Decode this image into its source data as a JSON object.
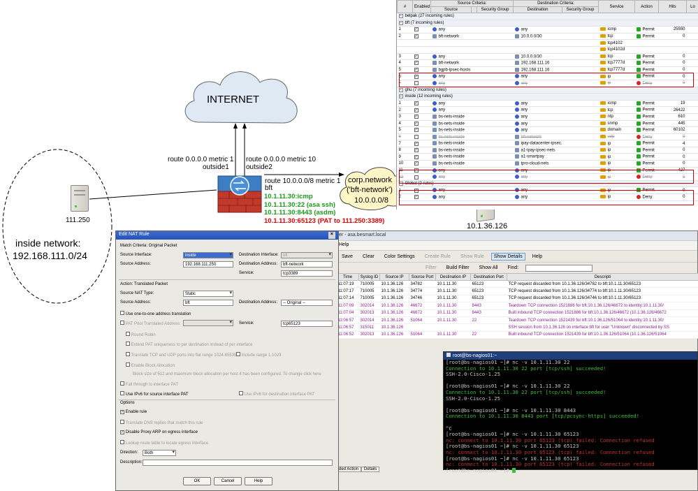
{
  "diagram": {
    "internet_label": "INTERNET",
    "route1": "route 0.0.0.0 metric 1",
    "route1_iface": "outside1",
    "route2": "route 0.0.0.0 metric 10",
    "route2_iface": "outside2",
    "route3": "route 10.0.0.0/8 metric 1",
    "route3_iface": "bft",
    "fw_lines": [
      {
        "text": "10.1.11.30:icmp",
        "color": "#1a9a1a"
      },
      {
        "text": "10.1.11.30:22 (asa ssh)",
        "color": "#1a9a1a"
      },
      {
        "text": "10.1.11.30:8443 (asdm)",
        "color": "#1a9a1a"
      },
      {
        "text": "10.1.11.30:65123 (PAT to 111.250:3389)",
        "color": "#e00000"
      }
    ],
    "corp_line1": "corp.network",
    "corp_line2": "('bft-network')",
    "corp_line3": "10.0.0.0/8",
    "left_server_label": "111.250",
    "inside_line1": "inside network:",
    "inside_line2": "192.168.111.0/24",
    "right_server_label": "10.1.36.126"
  },
  "acl": {
    "headers": {
      "num": "#",
      "enabled": "Enabled",
      "src_crit": "Source Criteria:",
      "dst_crit": "Destination Criteria:",
      "source": "Source",
      "sg": "Security Group",
      "destination": "Destination",
      "dsg": "Security Group",
      "service": "Service",
      "action": "Action",
      "hits": "Hits",
      "lo": "Lo"
    },
    "rows": [
      {
        "type": "grp",
        "text": "belpak (27 incoming rules)"
      },
      {
        "type": "grp",
        "text": "bft (7 incoming rules)"
      },
      {
        "n": "1",
        "src": "any",
        "dst": "any",
        "svc": "icmp",
        "act": "Permit",
        "hits": "25550"
      },
      {
        "n": "2",
        "src": "bft-network",
        "dst": "10.0.0.0/30",
        "svc": "tcp",
        "act": "Permit",
        "hits": "0"
      },
      {
        "n": "",
        "src": "",
        "dst": "",
        "svc": "tcp4102",
        "act": "",
        "hits": ""
      },
      {
        "n": "",
        "src": "",
        "dst": "",
        "svc": "tcp4102d",
        "act": "",
        "hits": ""
      },
      {
        "n": "3",
        "src": "any",
        "dst": "10.0.0.0/30",
        "svc": "tcp",
        "act": "Permit",
        "hits": "0"
      },
      {
        "n": "4",
        "src": "bft-network",
        "dst": "192.168.111.16",
        "svc": "tcp7777d",
        "act": "Permit",
        "hits": "0"
      },
      {
        "n": "5",
        "src": "bgpb-ipsec-hosts",
        "dst": "192.168.111.16",
        "svc": "tcp7777d",
        "act": "Permit",
        "hits": "0"
      },
      {
        "n": "6",
        "src": "any",
        "dst": "any",
        "svc": "ip",
        "act": "Permit",
        "hits": "0"
      },
      {
        "n": "7",
        "src": "any",
        "dst": "any",
        "svc": "ip",
        "act": "Deny",
        "hits": "0",
        "dis": true
      },
      {
        "type": "grp",
        "text": "ghu (7 incoming rules)"
      },
      {
        "type": "grp",
        "text": "inside (12 incoming rules)"
      },
      {
        "n": "1",
        "src": "any",
        "dst": "any",
        "svc": "icmp",
        "act": "Permit",
        "hits": "19"
      },
      {
        "n": "2",
        "src": "any",
        "dst": "any",
        "svc": "tcp",
        "act": "Permit",
        "hits": "26422"
      },
      {
        "n": "3",
        "src": "bs-nets-inside",
        "dst": "any",
        "svc": "ntp",
        "act": "Permit",
        "hits": "610"
      },
      {
        "n": "4",
        "src": "bs-nets-inside",
        "dst": "any",
        "svc": "snmp",
        "act": "Permit",
        "hits": "445"
      },
      {
        "n": "5",
        "src": "bs-nets-inside",
        "dst": "any",
        "svc": "domain",
        "act": "Permit",
        "hits": "60102"
      },
      {
        "n": "6",
        "src": "bs-nets-inside",
        "dst": "bft-network",
        "svc": "udp",
        "act": "Deny",
        "hits": "0",
        "dis": true
      },
      {
        "n": "7",
        "src": "bs-nets-inside",
        "dst": "ipay-datacenter-ipsec...",
        "svc": "ip",
        "act": "Permit",
        "hits": "4"
      },
      {
        "n": "8",
        "src": "bs-nets-inside",
        "dst": "a1-ipay-ipsec-nets",
        "svc": "ip",
        "act": "Permit",
        "hits": "0"
      },
      {
        "n": "9",
        "src": "bs-nets-inside",
        "dst": "a1-smartpay",
        "svc": "ip",
        "act": "Permit",
        "hits": "0"
      },
      {
        "n": "10",
        "src": "bs-nets-inside",
        "dst": "tpro-cloud-nets",
        "svc": "ip",
        "act": "Permit",
        "hits": "0"
      },
      {
        "n": "11",
        "src": "any",
        "dst": "any",
        "svc": "ip",
        "act": "Permit",
        "hits": "427"
      },
      {
        "n": "12",
        "src": "any",
        "dst": "any",
        "svc": "ip",
        "act": "Deny",
        "hits": "0",
        "dis": true
      },
      {
        "type": "grp",
        "text": "Global (2 rules)"
      },
      {
        "n": "1",
        "src": "any",
        "dst": "any",
        "svc": "ip",
        "act": "Permit",
        "hits": "0"
      },
      {
        "n": "2",
        "src": "any",
        "dst": "any",
        "svc": "ip",
        "act": "Deny",
        "hits": "0"
      }
    ]
  },
  "logwin": {
    "title": "er - asa.besmart.local",
    "menu_help": "Help",
    "buttons": [
      "Save",
      "Clear",
      "Color Settings",
      "Create Rule",
      "Show Rule",
      "Show Details",
      "Help"
    ],
    "filter_buttons": [
      "Filter",
      "Build Filter",
      "Show All"
    ],
    "find_label": "Find:",
    "headers": [
      "Time",
      "Syslog ID",
      "Source IP",
      "Source Port",
      "Destination IP",
      "Destination Port",
      "Descripti"
    ],
    "rows": [
      {
        "t": "11:07:19",
        "id": "710005",
        "sip": "10.1.36.126",
        "sp": "34782",
        "dip": "10.1.11.30",
        "dp": "65123",
        "d": "TCP request discarded from 10.1.36.126/34782 to bft:10.1.11.30/65123",
        "c": ""
      },
      {
        "t": "11:07:17",
        "id": "710005",
        "sip": "10.1.36.126",
        "sp": "34774",
        "dip": "10.1.11.30",
        "dp": "65123",
        "d": "TCP request discarded from 10.1.36.126/34774 to bft:10.1.11.30/65123",
        "c": ""
      },
      {
        "t": "11:07:14",
        "id": "710005",
        "sip": "10.1.36.126",
        "sp": "34746",
        "dip": "10.1.11.30",
        "dp": "65123",
        "d": "TCP request discarded from 10.1.36.126/34746 to bft:10.1.11.30/65123",
        "c": ""
      },
      {
        "t": "11:07:09",
        "id": "302014",
        "sip": "10.1.36.126",
        "sp": "46672",
        "dip": "10.1.11.30",
        "dp": "8443",
        "d": "Teardown TCP connection 1521886 for bft:10.1.36.126/46672 to identity:10.1.11.30/",
        "c": "pur"
      },
      {
        "t": "11:07:04",
        "id": "302013",
        "sip": "10.1.36.126",
        "sp": "46672",
        "dip": "10.1.11.30",
        "dp": "8443",
        "d": "Built inbound TCP connection 1521886 for bft:10.1.36.126/46672 (10.1.36.126/46672",
        "c": "pur"
      },
      {
        "t": "11:06:57",
        "id": "302014",
        "sip": "10.1.36.126",
        "sp": "51064",
        "dip": "10.1.11.30",
        "dp": "22",
        "d": "Teardown TCP connection 1521439 for bft:10.1.36.126/51064 to identity:10.1.11.30/",
        "c": "pur"
      },
      {
        "t": "11:06:57",
        "id": "315011",
        "sip": "10.1.36.126",
        "sp": "",
        "dip": "",
        "dp": "",
        "d": "SSH session from 10.1.36.126 on interface bft for user \"Unknown\" disconnected by SS",
        "c": "pur"
      },
      {
        "t": "11:06:52",
        "id": "302013",
        "sip": "10.1.36.126",
        "sp": "51064",
        "dip": "10.1.11.30",
        "dp": "22",
        "d": "Built inbound TCP connection 1521439 for bft:10.1.36.126/51064 (10.1.36.126/51064",
        "c": "pur"
      }
    ],
    "bottom_tabs": [
      "ded Action",
      "Details"
    ]
  },
  "nat": {
    "title": "Edit NAT Rule",
    "close": "×",
    "sec1": "Match Criteria: Original Packet",
    "src_iface_label": "Source Interface:",
    "src_iface": "inside",
    "dst_iface_label": "Destination Interface:",
    "dst_iface": "bft",
    "src_addr_label": "Source Address:",
    "src_addr": "192.168.111.250",
    "dst_addr_label": "Destination Address:",
    "dst_addr": "bft-network",
    "service_label": "Service:",
    "service": "tcp3389",
    "sec2": "Action: Translated Packet",
    "nat_type_label": "Source NAT Type:",
    "nat_type": "Static",
    "t_src_label": "Source Address:",
    "t_src": "bft",
    "t_dst_label": "Destination Address:",
    "t_dst": "-- Original --",
    "one_to_one": "Use one-to-one address translation",
    "pat_pool": "PAT Pool Translated Address:",
    "t_service_label": "Service:",
    "t_service": "tcp65123",
    "round_robin": "Round Robin",
    "extend_pat": "Extend PAT uniqueness to per destination instead of per interface",
    "translate_tcp": "Translate TCP and UDP ports into flat range 1024-65535",
    "include_range": "Include range 1-1023",
    "block_alloc": "Enable Block Allocation",
    "block_note": "Block size of 512 and maximum block allocation per host 4 has been configured. To change click here",
    "fall_through": "Fall through to interface PAT",
    "ipv6_src": "Use IPv6 for source interface PAT",
    "ipv6_dst": "Use IPv6 for destination interface PAT",
    "options": "Options",
    "enable_rule": "Enable rule",
    "translate_dns": "Translate DNS replies that match this rule",
    "disable_arp": "Disable Proxy ARP on egress interface",
    "lookup_route": "Lookup route table to locate egress interface",
    "direction_label": "Direction:",
    "direction": "Both",
    "description_label": "Description:",
    "ok": "OK",
    "cancel": "Cancel",
    "help": "Help"
  },
  "terminal": {
    "title": "root@bs-nagios01:~",
    "lines": [
      {
        "t": "[root@bs-nagios01 ~]# nc -v 10.1.11.30 22",
        "c": ""
      },
      {
        "t": "Connection to 10.1.11.30 22 port [tcp/ssh] succeeded!",
        "c": "g"
      },
      {
        "t": "SSH-2.0-Cisco-1.25",
        "c": ""
      },
      {
        "t": "",
        "c": ""
      },
      {
        "t": "[root@bs-nagios01 ~]# nc -v 10.1.11.30 22",
        "c": ""
      },
      {
        "t": "Connection to 10.1.11.30 22 port [tcp/ssh] succeeded!",
        "c": "g"
      },
      {
        "t": "SSH-2.0-Cisco-1.25",
        "c": ""
      },
      {
        "t": "",
        "c": ""
      },
      {
        "t": "[root@bs-nagios01 ~]# nc -v 10.1.11.30 8443",
        "c": ""
      },
      {
        "t": "Connection to 10.1.11.30 8443 port [tcp/pcsync-https] succeeded!",
        "c": "g"
      },
      {
        "t": "",
        "c": ""
      },
      {
        "t": "^C",
        "c": ""
      },
      {
        "t": "[root@bs-nagios01 ~]# nc -v 10.1.11.30 65123",
        "c": ""
      },
      {
        "t": "nc: connect to 10.1.11.30 port 65123 (tcp) failed: Connection refused",
        "c": "r"
      },
      {
        "t": "[root@bs-nagios01 ~]# nc -v 10.1.11.30 65123",
        "c": ""
      },
      {
        "t": "nc: connect to 10.1.11.30 port 65123 (tcp) failed: Connection refused",
        "c": "r"
      },
      {
        "t": "[root@bs-nagios01 ~]# nc -v 10.1.11.30 65123",
        "c": ""
      },
      {
        "t": "nc: connect to 10.1.11.30 port 65123 (tcp) failed: Connection refused",
        "c": "r"
      },
      {
        "t": "[root@bs-nagios01 ~]# ",
        "c": ""
      }
    ]
  }
}
